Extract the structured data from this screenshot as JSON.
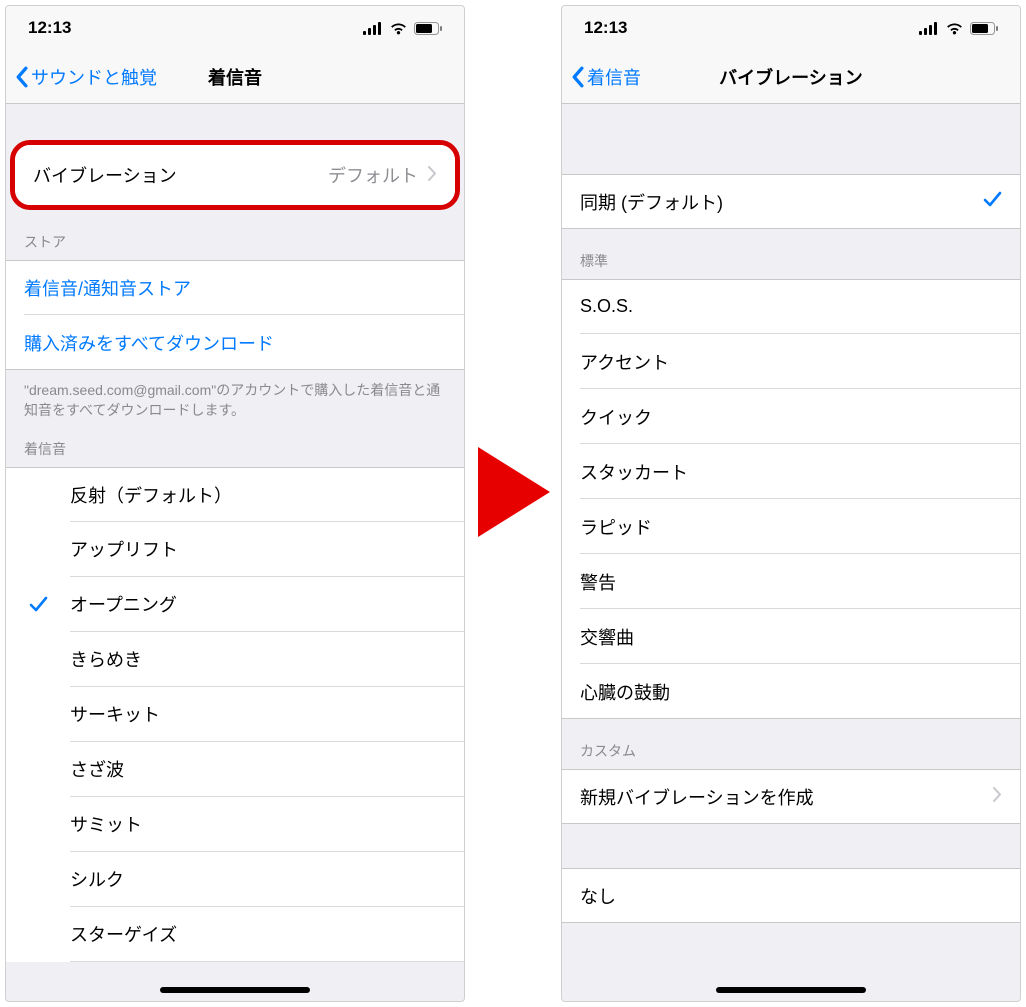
{
  "status": {
    "time": "12:13"
  },
  "arrow": {
    "semantic": "arrow-right"
  },
  "left": {
    "nav": {
      "back": "サウンドと触覚",
      "title": "着信音"
    },
    "vibration": {
      "label": "バイブレーション",
      "value": "デフォルト"
    },
    "storeHeader": "ストア",
    "storeLinks": {
      "toneStore": "着信音/通知音ストア",
      "downloadAll": "購入済みをすべてダウンロード"
    },
    "storeFooter": "\"dream.seed.com@gmail.com\"のアカウントで購入した着信音と通知音をすべてダウンロードします。",
    "ringtonesHeader": "着信音",
    "ringtones": [
      {
        "label": "反射（デフォルト）",
        "checked": false
      },
      {
        "label": "アップリフト",
        "checked": false
      },
      {
        "label": "オープニング",
        "checked": true
      },
      {
        "label": "きらめき",
        "checked": false
      },
      {
        "label": "サーキット",
        "checked": false
      },
      {
        "label": "さざ波",
        "checked": false
      },
      {
        "label": "サミット",
        "checked": false
      },
      {
        "label": "シルク",
        "checked": false
      },
      {
        "label": "スターゲイズ",
        "checked": false
      }
    ]
  },
  "right": {
    "nav": {
      "back": "着信音",
      "title": "バイブレーション"
    },
    "sync": {
      "label": "同期 (デフォルト)",
      "checked": true
    },
    "standardHeader": "標準",
    "standard": [
      "S.O.S.",
      "アクセント",
      "クイック",
      "スタッカート",
      "ラピッド",
      "警告",
      "交響曲",
      "心臓の鼓動"
    ],
    "customHeader": "カスタム",
    "createNew": "新規バイブレーションを作成",
    "none": "なし"
  }
}
